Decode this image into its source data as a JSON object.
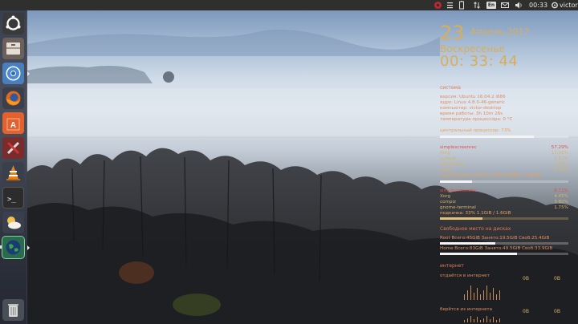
{
  "top_panel": {
    "time": "00:33",
    "user": "victor",
    "keyboard_layout": "En",
    "icons": [
      "record-icon",
      "menu-icon",
      "battery-icon",
      "network-arrows-icon",
      "keyboard-icon",
      "mail-icon",
      "volume-icon",
      "power-gear-icon"
    ]
  },
  "launcher": {
    "items": [
      {
        "name": "ubuntu-dash",
        "icon": "ubuntu-logo-icon",
        "color": "#3a3a3a"
      },
      {
        "name": "files",
        "icon": "file-cabinet-icon",
        "color": "#7a6f63"
      },
      {
        "name": "chromium",
        "icon": "chromium-icon",
        "color": "#4a7fbf"
      },
      {
        "name": "firefox",
        "icon": "firefox-icon",
        "color": "#e1671c"
      },
      {
        "name": "software-center",
        "icon": "shopping-bag-icon",
        "color": "#e2612e"
      },
      {
        "name": "system-settings",
        "icon": "tools-icon",
        "color": "#b53a3a"
      },
      {
        "name": "vlc",
        "icon": "traffic-cone-icon",
        "color": "#e88215"
      },
      {
        "name": "terminal",
        "icon": "terminal-icon",
        "color": "#2c2c2c"
      },
      {
        "name": "weather",
        "icon": "sun-cloud-icon",
        "color": "#e0d4b0"
      },
      {
        "name": "globe-app",
        "icon": "globe-icon",
        "color": "#2b6b4d"
      },
      {
        "name": "trash",
        "icon": "trash-icon",
        "color": "#555"
      }
    ]
  },
  "conky": {
    "day": "23",
    "month_year": "Апрель 2017",
    "weekday": "Воскресенье",
    "time": "00: 33: 44",
    "system": {
      "heading": "система",
      "lines": [
        "версия: Ubuntu 16.04.2 i686",
        "ядро: Linux 4.8.0-46-generic",
        "компьютер: victor-desktop",
        "время работы: 3h 10m 26s",
        "температура процессора: 0 °C"
      ]
    },
    "cpu": {
      "label": "центральный процессор: 73%",
      "value": 0.73,
      "processes": [
        {
          "name": "simplescreenrec",
          "value": "57.29%"
        },
        {
          "name": "Xorg",
          "value": "11.06%"
        },
        {
          "name": "compiz",
          "value": "2.51%"
        },
        {
          "name": "pulseaudio",
          "value": "1.51%"
        },
        {
          "name": "conky",
          "value": "0.00%"
        }
      ]
    },
    "ram": {
      "label": "оперативная память: 25% 504MB / 1.96GiB",
      "value": 0.25,
      "processes": [
        {
          "name": "simplescreenrec",
          "value": "8.71%"
        },
        {
          "name": "Xorg",
          "value": "4.45%"
        },
        {
          "name": "compiz",
          "value": "3.80%"
        },
        {
          "name": "gnome-terminal",
          "value": "1.75%"
        }
      ]
    },
    "swap": {
      "label": "подкачка: 33% 1.1GiB / 1.6GiB",
      "value": 0.33
    },
    "disk": {
      "heading": "Свободное место на дисках",
      "root": {
        "label": "Root Всего:45GiB Занято:19.5GiB Своб:25.4GiB",
        "value": 0.43
      },
      "home": {
        "label": "Home Всего:83GiB Занято:49.5GiB Своб:33.9GiB",
        "value": 0.6
      }
    },
    "network": {
      "heading": "интернет",
      "upload_label": "отдаётся в интернет",
      "upload_value": "0B",
      "upload_total": "0B",
      "download_label": "берётся из интернета",
      "download_value": "0B",
      "download_total": "0B"
    }
  }
}
